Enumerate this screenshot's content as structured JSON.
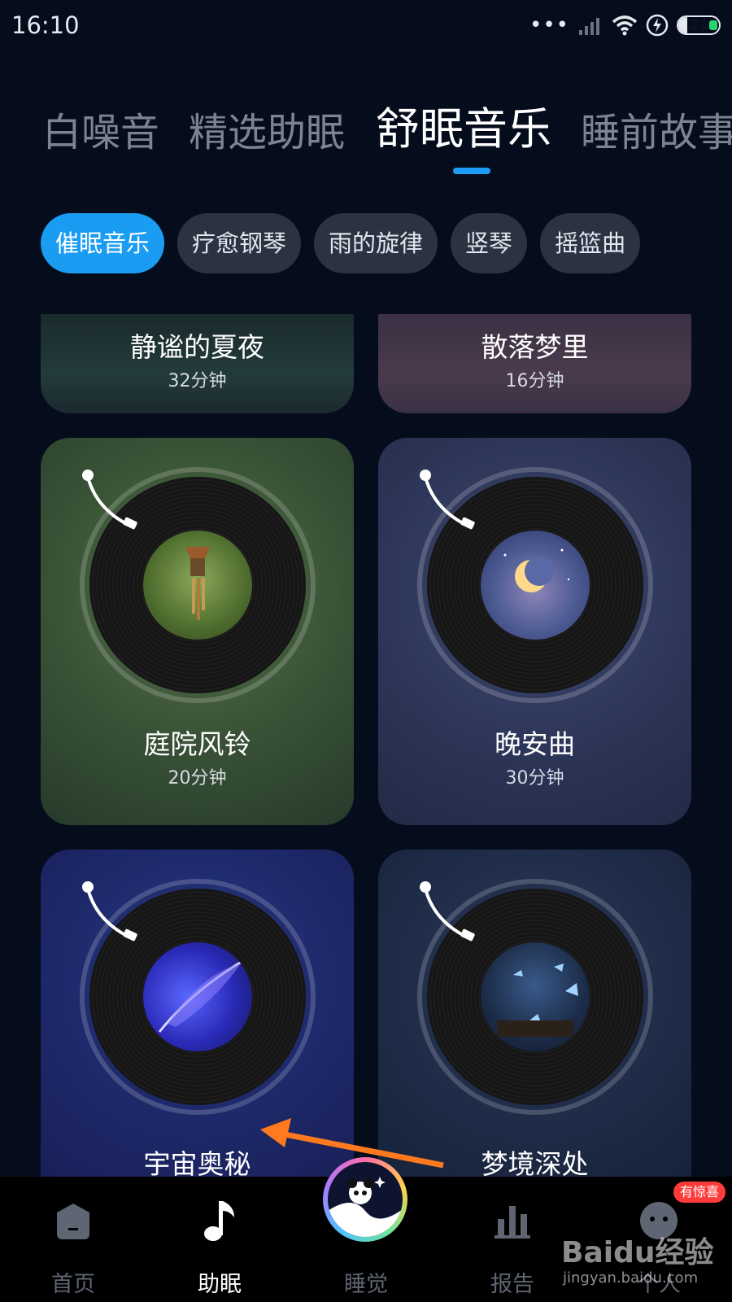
{
  "status_bar": {
    "time": "16:10",
    "battery": "21",
    "battery_level": 0.21,
    "icons": [
      "more-dots-icon",
      "signal-icon",
      "wifi-icon",
      "charging-icon",
      "battery-icon"
    ]
  },
  "top_tabs": [
    {
      "label": "白噪音",
      "active": false
    },
    {
      "label": "精选助眠",
      "active": false
    },
    {
      "label": "舒眠音乐",
      "active": true
    },
    {
      "label": "睡前故事",
      "active": false
    }
  ],
  "chips": [
    {
      "label": "催眠音乐",
      "active": true
    },
    {
      "label": "疗愈钢琴",
      "active": false
    },
    {
      "label": "雨的旋律",
      "active": false
    },
    {
      "label": "竖琴",
      "active": false
    },
    {
      "label": "摇篮曲",
      "active": false
    }
  ],
  "cards": [
    {
      "title": "静谧的夏夜",
      "duration": "32分钟"
    },
    {
      "title": "散落梦里",
      "duration": "16分钟"
    },
    {
      "title": "庭院风铃",
      "duration": "20分钟"
    },
    {
      "title": "晚安曲",
      "duration": "30分钟"
    },
    {
      "title": "宇宙奥秘",
      "duration": ""
    },
    {
      "title": "梦境深处",
      "duration": ""
    }
  ],
  "bottom_nav": [
    {
      "label": "首页",
      "icon": "home-icon",
      "active": false
    },
    {
      "label": "助眠",
      "icon": "music-note-icon",
      "active": true
    },
    {
      "label": "睡觉",
      "icon": "panda-moon-icon",
      "active": false
    },
    {
      "label": "报告",
      "icon": "bar-chart-icon",
      "active": false
    },
    {
      "label": "个人",
      "icon": "profile-icon",
      "active": false
    }
  ],
  "badge": "有惊喜",
  "watermark": {
    "brand": "Baidu经验",
    "url": "jingyan.baidu.com"
  },
  "colors": {
    "accent": "#1a9cf2",
    "background": "#050c1c",
    "badge": "#ff3b3b"
  }
}
